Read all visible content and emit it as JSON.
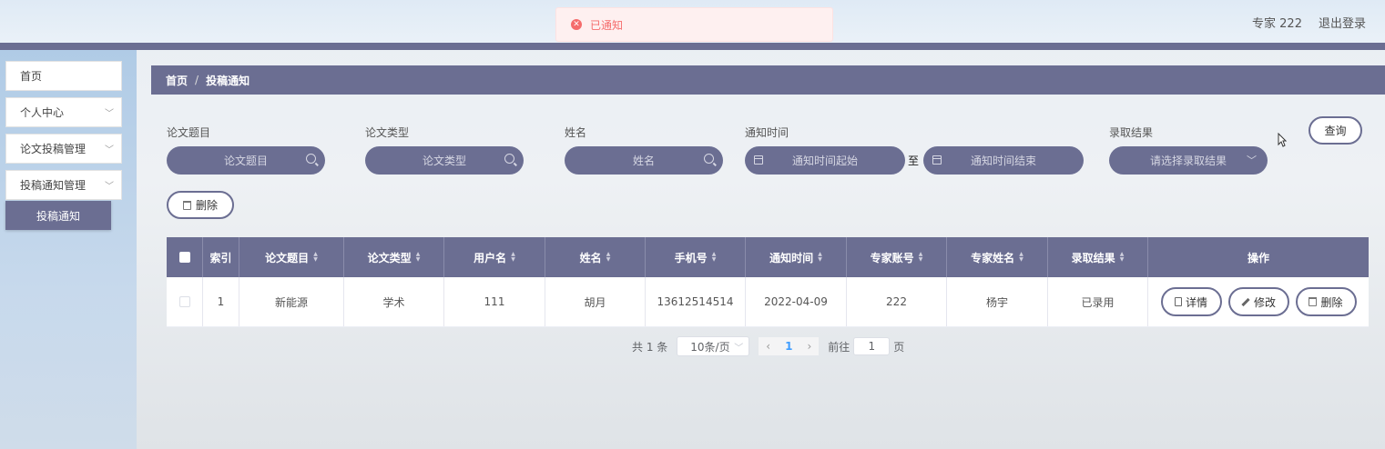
{
  "header": {
    "toast": "已通知",
    "user": "专家 222",
    "logout": "退出登录"
  },
  "sidebar": {
    "items": [
      {
        "label": "首页"
      },
      {
        "label": "个人中心"
      },
      {
        "label": "论文投稿管理"
      },
      {
        "label": "投稿通知管理"
      }
    ],
    "active_sub": "投稿通知"
  },
  "breadcrumb": {
    "home": "首页",
    "sep": "/",
    "current": "投稿通知"
  },
  "search": {
    "title_label": "论文题目",
    "title_placeholder": "论文题目",
    "type_label": "论文类型",
    "type_placeholder": "论文类型",
    "name_label": "姓名",
    "name_placeholder": "姓名",
    "time_label": "通知时间",
    "time_start": "通知时间起始",
    "time_to": "至",
    "time_end": "通知时间结束",
    "result_label": "录取结果",
    "result_placeholder": "请选择录取结果",
    "query_button": "查询",
    "delete_button": "删除"
  },
  "table": {
    "columns": [
      "索引",
      "论文题目",
      "论文类型",
      "用户名",
      "姓名",
      "手机号",
      "通知时间",
      "专家账号",
      "专家姓名",
      "录取结果",
      "操作"
    ],
    "rows": [
      [
        "1",
        "新能源",
        "学术",
        "111",
        "胡月",
        "13612514514",
        "2022-04-09",
        "222",
        "杨宇",
        "已录用"
      ]
    ],
    "actions": {
      "detail": "详情",
      "edit": "修改",
      "delete": "删除"
    }
  },
  "pagination": {
    "total": "共 1 条",
    "page_size": "10条/页",
    "current": "1",
    "goto_label": "前往",
    "goto_value": "1",
    "page_suffix": "页"
  },
  "colors": {
    "accent": "#6b6e92",
    "error": "#f56c6c",
    "link": "#409eff"
  }
}
